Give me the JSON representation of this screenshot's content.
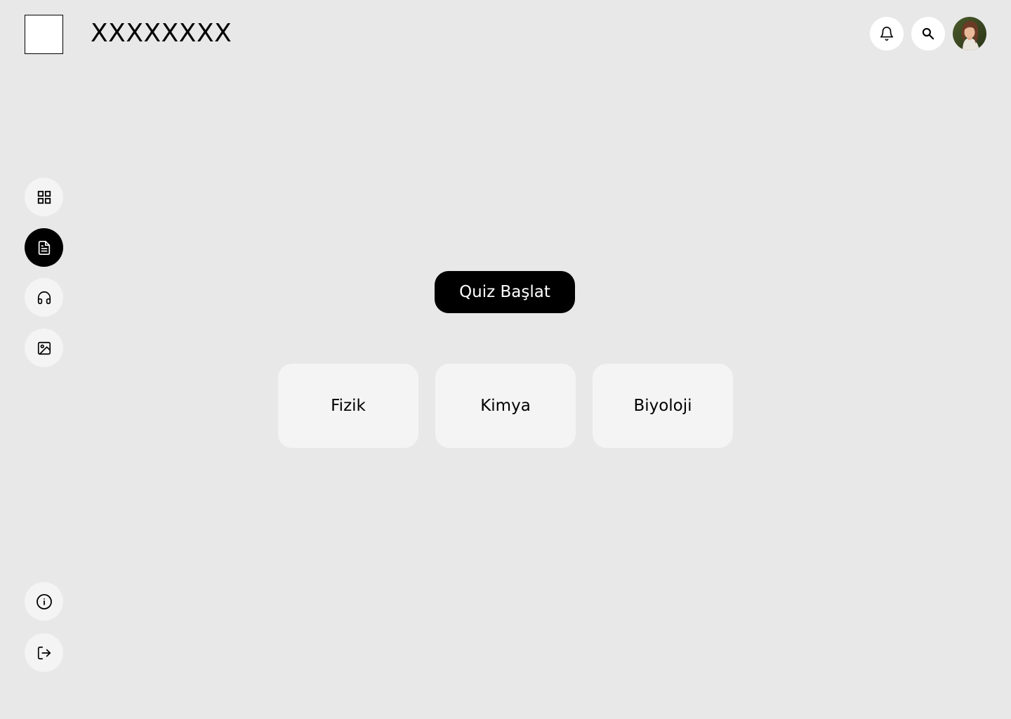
{
  "header": {
    "title": "XXXXXXXX",
    "notification_icon": "bell-icon",
    "search_icon": "search-icon",
    "avatar_icon": "user-avatar"
  },
  "sidebar": {
    "items": [
      {
        "icon": "dashboard-grid-icon",
        "active": false
      },
      {
        "icon": "document-icon",
        "active": true
      },
      {
        "icon": "headphones-icon",
        "active": false
      },
      {
        "icon": "image-icon",
        "active": false
      }
    ],
    "bottom_items": [
      {
        "icon": "info-icon"
      },
      {
        "icon": "logout-icon"
      }
    ]
  },
  "main": {
    "start_button_label": "Quiz Başlat",
    "subjects": [
      "Fizik",
      "Kimya",
      "Biyoloji"
    ]
  },
  "colors": {
    "background": "#e8e8e8",
    "accent": "#000000",
    "card": "#f4f4f4"
  }
}
